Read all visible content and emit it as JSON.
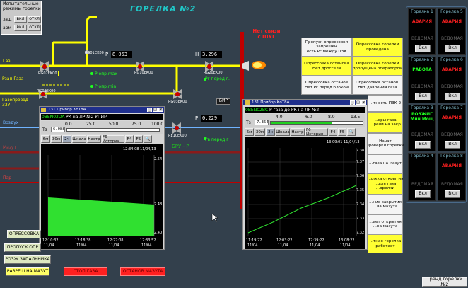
{
  "test_modes": {
    "title": "Испытательные\nрежимы горелки",
    "zash_label": "защ",
    "arm_label": "арм",
    "vkl": "вкл",
    "otkl": "откл"
  },
  "header": {
    "title": "ГОРЕЛКА №2"
  },
  "pipes": {
    "gas": "Газ",
    "pzak_gas": "Рзап Газа",
    "gas_line": "Газопровод\n33У",
    "air": "Воздух",
    "mazut": "Мазут",
    "steam": "Пар"
  },
  "valves": {
    "rg01": "RG01CK00",
    "rg02": "RG02EK00",
    "rg10": "RG10EK00",
    "rg03": "RG03EK00",
    "rg20": "RG20EK00",
    "rg08": "RG08EK00",
    "re10": "RE10EK00"
  },
  "readouts": {
    "p": "P",
    "h": "H",
    "p_value1": "8.053",
    "h_value": "3.296",
    "p_value2": "0.229",
    "p_opr_max": "P опр.max",
    "p_opr_min": "P опр.min",
    "rg_pered": "Рг перед г.",
    "rv_pered": "Рв перед г",
    "bir": "БИР",
    "bru": "БРУ - Р"
  },
  "shug": {
    "text": "Нет связи\nс ШУГ"
  },
  "status_grid": [
    {
      "text": "Пропуск опрессовки\nзапрещен\nесть Рг между ПЗК",
      "yellow": false
    },
    {
      "text": "Опрессовка горелки\nпроведена",
      "yellow": true
    },
    {
      "text": "Опрессовка останова\nНет дросселя",
      "yellow": true
    },
    {
      "text": "Опрессовка горелки\nпропущена оператором",
      "yellow": true
    },
    {
      "text": "Опрессовка останов\nНет Рг перед блоком",
      "yellow": false
    },
    {
      "text": "Опрессовка останов.\nНет давления газа",
      "yellow": false
    },
    {
      "text": "...тность ПЗК-2",
      "yellow": false
    },
    {
      "text": "...еры газа\n...рели на закр",
      "yellow": true
    },
    {
      "text": "Начат\nпроверки горелки",
      "yellow": false
    },
    {
      "text": "...газа на мазут",
      "yellow": false
    },
    {
      "text": "...ржка открытия\n...для газа\n...орелки",
      "yellow": true
    },
    {
      "text": "...ние закрытия\n...ва мазута",
      "yellow": false
    },
    {
      "text": "...ает открытия\n...на мазута",
      "yellow": false
    },
    {
      "text": "...тная горелка\nработает",
      "yellow": true
    }
  ],
  "window1": {
    "title": "131 Прибор КоТ8А",
    "tag": "0BEN02DA",
    "desc": "РК на ЛР №2 УПИМ",
    "scale": [
      "0.0",
      "25.0",
      "50.0",
      "75.0",
      "100.0"
    ],
    "tz_label": "Тз",
    "tz_value": "6.088",
    "buttons": [
      "6м",
      "30м",
      "2ч",
      "Шкала",
      "Настр",
      "F6 История",
      "F4",
      "F5"
    ],
    "timestamp": "12:34:08  11/04/13",
    "y_labels": [
      "2.54",
      "2.48",
      "2.40"
    ],
    "x_labels": [
      [
        "12:10:32",
        "11/04"
      ],
      [
        "12:18:38",
        "11/04"
      ],
      [
        "12:27:08",
        "11/04"
      ],
      [
        "12:33:52",
        "11/04"
      ]
    ]
  },
  "window2": {
    "title": "131 Прибор КоТ8А",
    "tag": "0BEN02BC",
    "desc": "Р газа до РК на ЛР №2",
    "scale": [
      "4.0",
      "6.0",
      "8.0",
      "13.5"
    ],
    "tz_label": "Тз",
    "tz_value": "7.364",
    "buttons": [
      "6м",
      "30м",
      "2ч",
      "Шкала",
      "Настр",
      "F6 История",
      "F4",
      "F5"
    ],
    "timestamp": "13:09:01  11/04/13",
    "y_labels": [
      "7.38",
      "7.37",
      "7.36",
      "7.35",
      "7.34",
      "7.33",
      "7.32"
    ],
    "x_labels": [
      [
        "11:19:22",
        "11/04"
      ],
      [
        "12:03:22",
        "11/04"
      ],
      [
        "12:39:22",
        "11/04"
      ],
      [
        "13:08:22",
        "11/04"
      ]
    ]
  },
  "burners": [
    {
      "name": "Горелка 1",
      "status": "АВАРИЯ",
      "status_color": "#ff2020",
      "btn": "Вкл"
    },
    {
      "name": "Горелка 5",
      "status": "АВАРИЯ",
      "status_color": "#ff2020",
      "btn": "Вкл"
    },
    {
      "name": "Горелка 2",
      "status": "РАБОТА",
      "status_color": "#20ff20",
      "btn": "Вкл"
    },
    {
      "name": "Горелка 6",
      "status": "АВАРИЯ",
      "status_color": "#ff2020",
      "btn": "Вкл"
    },
    {
      "name": "Горелка 3",
      "status": "РОЗЖИГ\nМин Мощ",
      "status_color": "#20ff20",
      "btn": "Вкл"
    },
    {
      "name": "Горелка 7",
      "status": "АВАРИЯ",
      "status_color": "#ff2020",
      "btn": "Вкл"
    },
    {
      "name": "Горелка 4",
      "status": "",
      "status_color": "#ff2020",
      "btn": "Вкл"
    },
    {
      "name": "Горелка 8",
      "status": "АВАРИЯ",
      "status_color": "#ff2020",
      "btn": "Вкл"
    }
  ],
  "vedomaya": "ВЕДОМАЯ",
  "bottom": {
    "opress": "ОПРЕССОВКА",
    "propusk": "ПРОПУСК ОПР",
    "rozzh": "РОЗЖ ЗАПАЛЬНИКА",
    "razresh": "РАЗРЕШ НА МАЗУТ",
    "stop_gas": "СТОП ГАЗА",
    "stop_mazut": "ОСТАНОВ МАЗУТА",
    "trend": "Тренд горелки №2"
  },
  "colors": {
    "gas": "#ffff00",
    "air": "#6fb3ff",
    "mazut": "#8a1a1a",
    "steam": "#c00000",
    "accent": "#1f2f8c"
  }
}
